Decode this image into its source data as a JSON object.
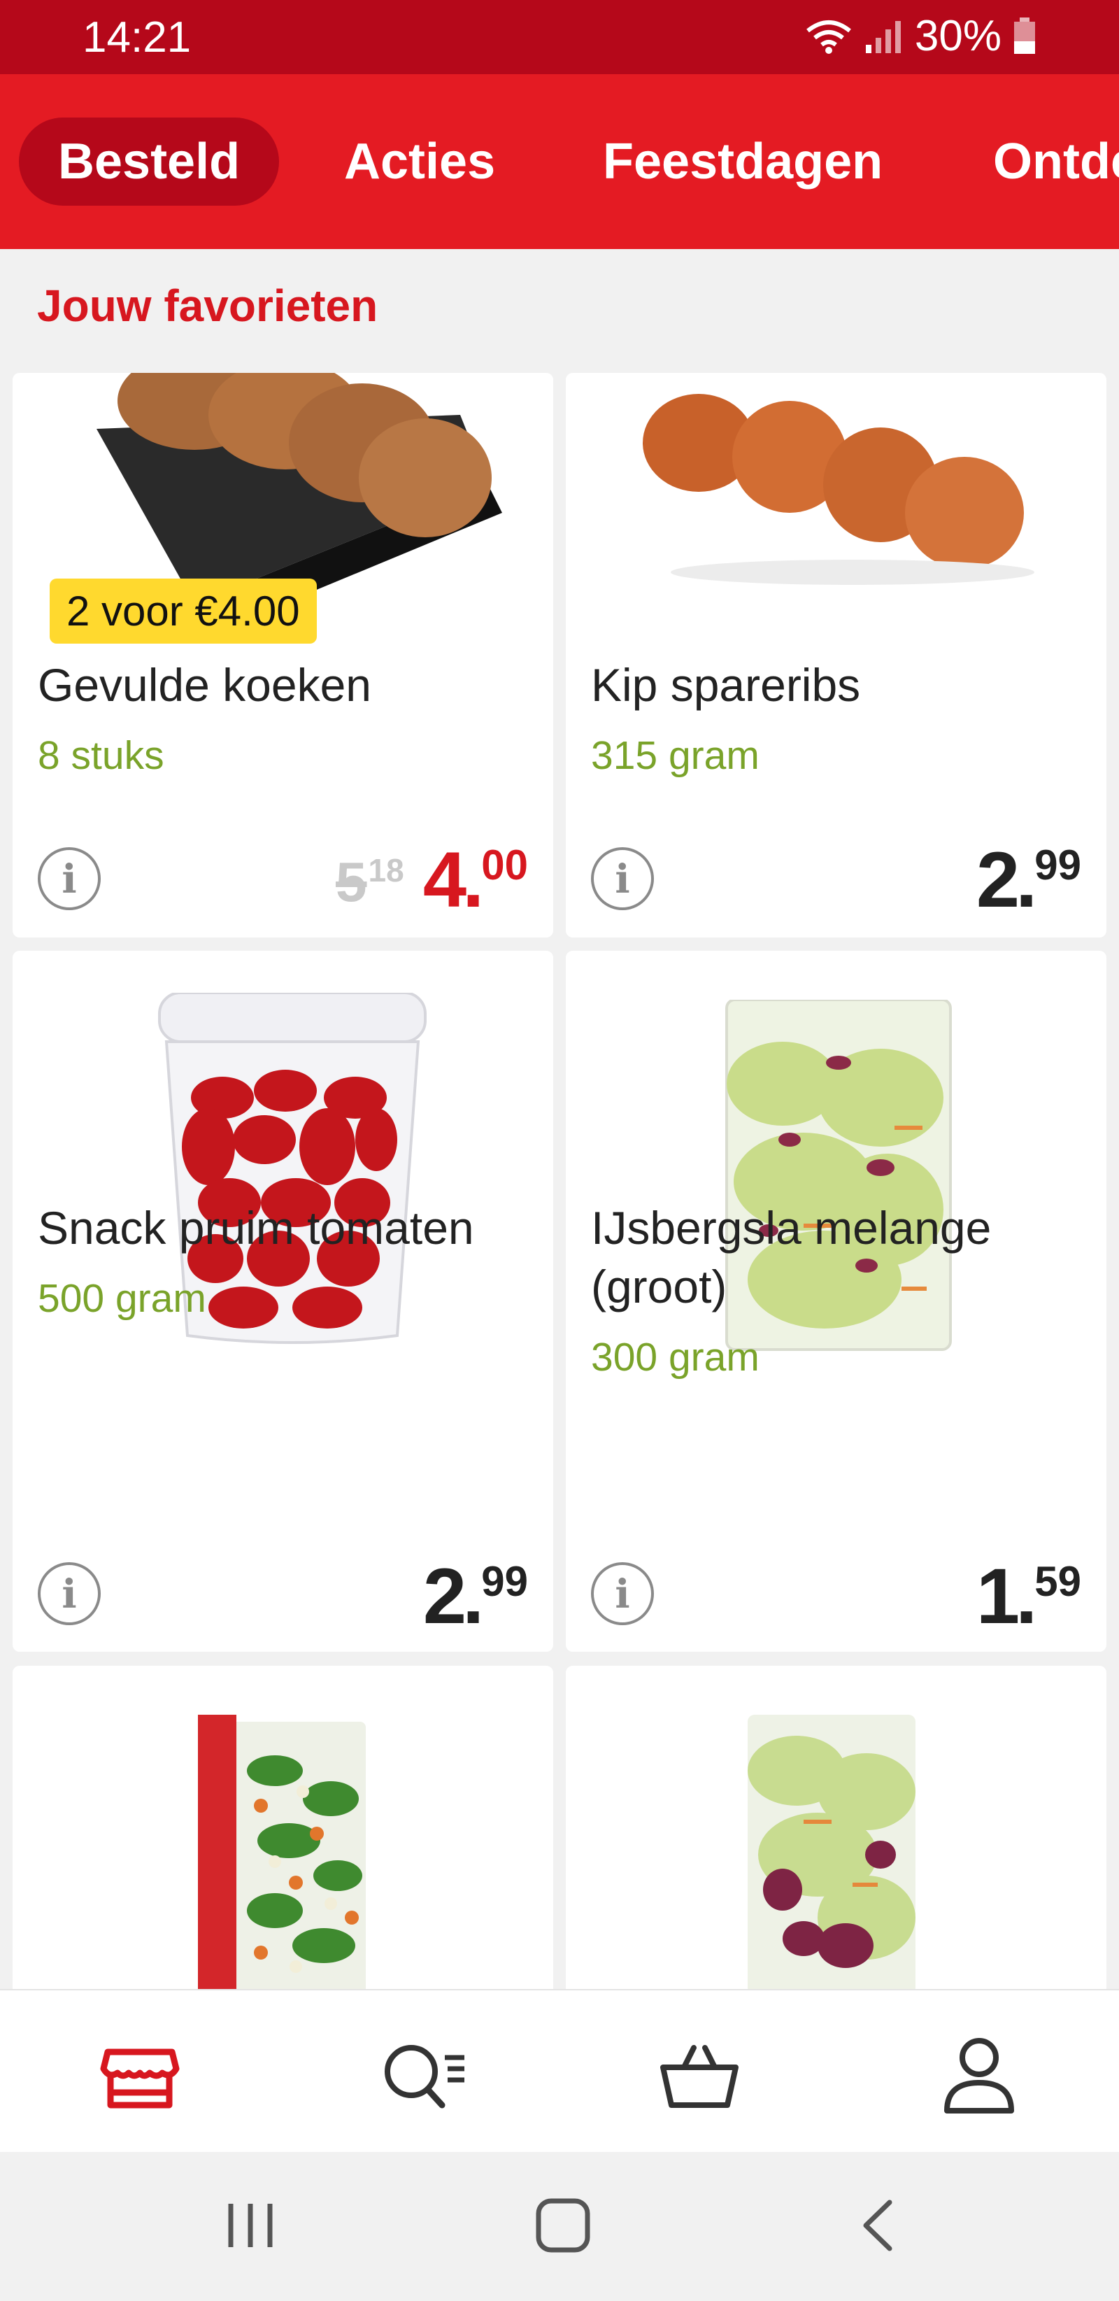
{
  "status_bar": {
    "time": "14:21",
    "battery": "30%"
  },
  "tabs": [
    {
      "label": "Besteld",
      "active": true
    },
    {
      "label": "Acties",
      "active": false
    },
    {
      "label": "Feestdagen",
      "active": false
    },
    {
      "label": "Ontdek",
      "active": false
    }
  ],
  "section_title": "Jouw favorieten",
  "products": [
    {
      "name": "Gevulde koeken",
      "unit": "8 stuks",
      "badge": "2 voor €4.00",
      "old_price": {
        "euros": "5",
        "cents": "18"
      },
      "price": {
        "euros": "4",
        "cents": "00"
      }
    },
    {
      "name": "Kip spareribs",
      "unit": "315 gram",
      "price": {
        "euros": "2",
        "cents": "99"
      }
    },
    {
      "name": "Snack pruim tomaten",
      "unit": "500 gram",
      "price": {
        "euros": "2",
        "cents": "99"
      }
    },
    {
      "name_line1": "IJsbergsla melange",
      "name_line2": "(groot)",
      "unit": "300 gram",
      "price": {
        "euros": "1",
        "cents": "59"
      }
    }
  ],
  "info_icon_glyph": "i",
  "colors": {
    "brand_red": "#e41b23",
    "dark_red": "#b5081a",
    "unit_green": "#7aa32a",
    "badge_yellow": "#ffd92e"
  },
  "bottom_nav": [
    "store-icon",
    "search-list-icon",
    "basket-icon",
    "profile-icon"
  ]
}
